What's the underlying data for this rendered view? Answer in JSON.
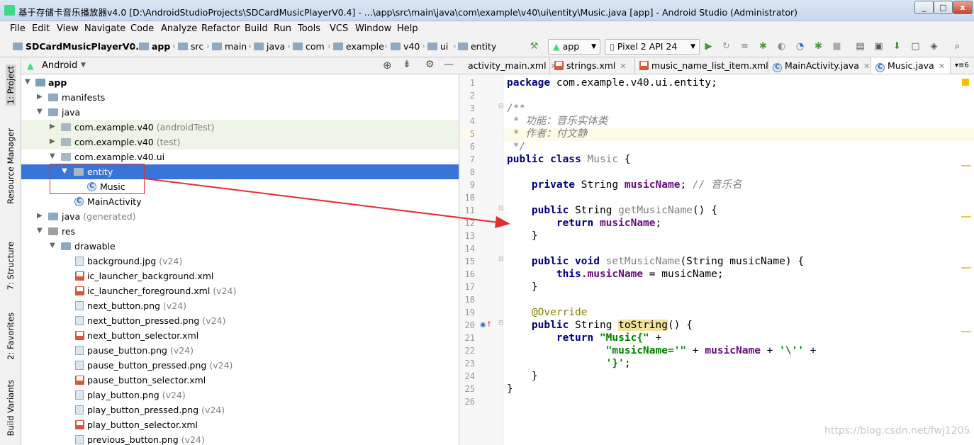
{
  "window": {
    "title": "基于存储卡音乐播放器v4.0 [D:\\AndroidStudioProjects\\SDCardMusicPlayerV0.4] - ...\\app\\src\\main\\java\\com\\example\\v40\\ui\\entity\\Music.java [app] - Android Studio (Administrator)",
    "minimize": "_",
    "maximize": "□",
    "close": "x"
  },
  "menu": [
    "File",
    "Edit",
    "View",
    "Navigate",
    "Code",
    "Analyze",
    "Refactor",
    "Build",
    "Run",
    "Tools",
    "VCS",
    "Window",
    "Help"
  ],
  "breadcrumb": [
    "SDCardMusicPlayerV0.4",
    "app",
    "src",
    "main",
    "java",
    "com",
    "example",
    "v40",
    "ui",
    "entity"
  ],
  "toolbar": {
    "module": "app",
    "device": "Pixel 2 API 24"
  },
  "sidebar": {
    "project": "1: Project",
    "resource": "Resource Manager",
    "structure": "7: Structure",
    "favorites": "2: Favorites",
    "build": "Build Variants"
  },
  "project_view": {
    "mode": "Android"
  },
  "tree": [
    {
      "label": "app",
      "hint": ""
    },
    {
      "label": "manifests",
      "hint": ""
    },
    {
      "label": "java",
      "hint": ""
    },
    {
      "label": "com.example.v40",
      "hint": "(androidTest)"
    },
    {
      "label": "com.example.v40",
      "hint": "(test)"
    },
    {
      "label": "com.example.v40.ui",
      "hint": ""
    },
    {
      "label": "entity",
      "hint": ""
    },
    {
      "label": "Music",
      "hint": ""
    },
    {
      "label": "MainActivity",
      "hint": ""
    },
    {
      "label": "java",
      "hint": "(generated)"
    },
    {
      "label": "res",
      "hint": ""
    },
    {
      "label": "drawable",
      "hint": ""
    },
    {
      "label": "background.jpg",
      "hint": "(v24)"
    },
    {
      "label": "ic_launcher_background.xml",
      "hint": ""
    },
    {
      "label": "ic_launcher_foreground.xml",
      "hint": "(v24)"
    },
    {
      "label": "next_button.png",
      "hint": "(v24)"
    },
    {
      "label": "next_button_pressed.png",
      "hint": "(v24)"
    },
    {
      "label": "next_button_selector.xml",
      "hint": ""
    },
    {
      "label": "pause_button.png",
      "hint": "(v24)"
    },
    {
      "label": "pause_button_pressed.png",
      "hint": "(v24)"
    },
    {
      "label": "pause_button_selector.xml",
      "hint": ""
    },
    {
      "label": "play_button.png",
      "hint": "(v24)"
    },
    {
      "label": "play_button_pressed.png",
      "hint": "(v24)"
    },
    {
      "label": "play_button_selector.xml",
      "hint": ""
    },
    {
      "label": "previous_button.png",
      "hint": "(v24)"
    }
  ],
  "tabs": [
    "activity_main.xml",
    "strings.xml",
    "music_name_list_item.xml",
    "MainActivity.java",
    "Music.java"
  ],
  "tabs_overflow": "6",
  "line_numbers": [
    "1",
    "2",
    "3",
    "4",
    "5",
    "6",
    "7",
    "8",
    "9",
    "10",
    "11",
    "12",
    "13",
    "14",
    "15",
    "16",
    "17",
    "18",
    "19",
    "20",
    "21",
    "22",
    "23",
    "24",
    "25",
    "26"
  ],
  "code": {
    "l1a": "package",
    "l1b": " com.example.v40.ui.entity;",
    "l3": "/**",
    "l4": " * 功能：音乐实体类",
    "l5": " * 作者：付文静",
    "l6": " */",
    "l7a": "public class",
    "l7b": " Music ",
    "l7c": "{",
    "l9a": "    private",
    "l9b": " String ",
    "l9c": "musicName",
    "l9d": "; ",
    "l9e": "// 音乐名",
    "l11a": "    public",
    "l11b": " String ",
    "l11c": "getMusicName",
    "l11d": "() {",
    "l12a": "        return",
    "l12b": " musicName",
    "l12c": ";",
    "l13": "    }",
    "l15a": "    public void",
    "l15b": " setMusicName",
    "l15c": "(String musicName) {",
    "l16a": "        this",
    "l16b": ".musicName",
    "l16c": " = musicName;",
    "l17": "    }",
    "l19": "    @Override",
    "l20a": "    public",
    "l20b": " String ",
    "l20c": "toString",
    "l20d": "() {",
    "l21a": "        return",
    "l21b": " \"Music{\"",
    "l21c": " +",
    "l22a": "                \"musicName='\"",
    "l22b": " + ",
    "l22c": "musicName",
    "l22d": " + ",
    "l22e": "'\\''",
    "l22f": " +",
    "l23a": "                '}'",
    "l23b": ";",
    "l24": "    }",
    "l25": "}"
  },
  "watermark": "https://blog.csdn.net/fwj1205",
  "colors": {
    "selection": "#3875d7",
    "annotation_arrow": "#e03030",
    "keyword": "#000080",
    "field": "#660e7a",
    "string": "#008000"
  }
}
